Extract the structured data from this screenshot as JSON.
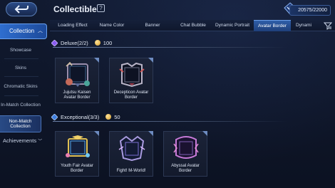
{
  "header": {
    "title": "Collectible",
    "currency": "20575/22000"
  },
  "sidebar": {
    "main": "Collection",
    "items": [
      {
        "label": "Showcase"
      },
      {
        "label": "Skins"
      },
      {
        "label": "Chromatic Skins"
      },
      {
        "label": "In-Match Collection"
      },
      {
        "label": "Non-Match Collection",
        "active": true
      }
    ],
    "achievements": "Achievements"
  },
  "tabs": [
    {
      "label": "Loading Effect"
    },
    {
      "label": "Name Color"
    },
    {
      "label": "Banner"
    },
    {
      "label": "Chat Bubble"
    },
    {
      "label": "Dynamic Portrait"
    },
    {
      "label": "Avatar Border",
      "active": true
    },
    {
      "label": "Dynami"
    }
  ],
  "sections": [
    {
      "title": "Deluxe(2/2)",
      "points": "100",
      "items": [
        {
          "label": "Jujutsu Kaisen Avatar Border"
        },
        {
          "label": "Decepticon Avatar Border"
        }
      ]
    },
    {
      "title": "Exceptional(3/3)",
      "points": "50",
      "items": [
        {
          "label": "Youth Fair Avatar Border"
        },
        {
          "label": "Fight! M-World!"
        },
        {
          "label": "Abyssal Avatar Border"
        }
      ]
    }
  ],
  "colors": {
    "accent": "#2f6ecf",
    "background": "#0d1324"
  }
}
